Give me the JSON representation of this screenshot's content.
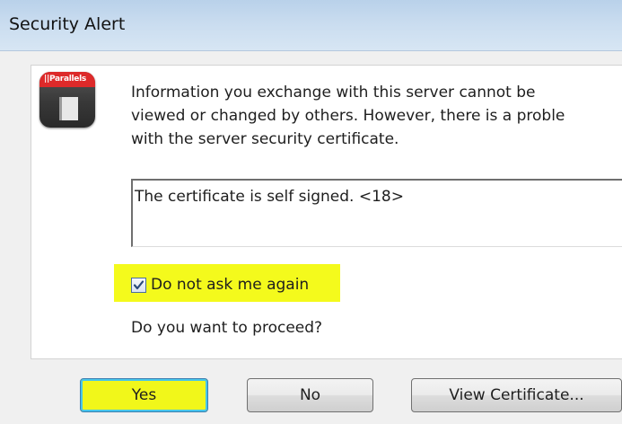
{
  "window": {
    "title": "Security Alert"
  },
  "app_icon": {
    "name": "parallels-icon",
    "brand_text": "||Parallels",
    "brand_color": "#dd2a2a"
  },
  "message": {
    "line1": "Information you exchange with this server cannot be",
    "line2": "viewed or changed by others. However, there is a proble",
    "line3": "with the server security certificate."
  },
  "certificate_box": {
    "text": "The certificate is self signed. <18>"
  },
  "checkbox": {
    "label": "Do not ask me again",
    "checked": true
  },
  "question": "Do you want to proceed?",
  "buttons": {
    "yes": "Yes",
    "no": "No",
    "view_certificate": "View Certificate..."
  },
  "colors": {
    "highlight": "#f4fa1c",
    "titlebar": "#c9dcef",
    "focus_ring": "#48c6e8"
  }
}
